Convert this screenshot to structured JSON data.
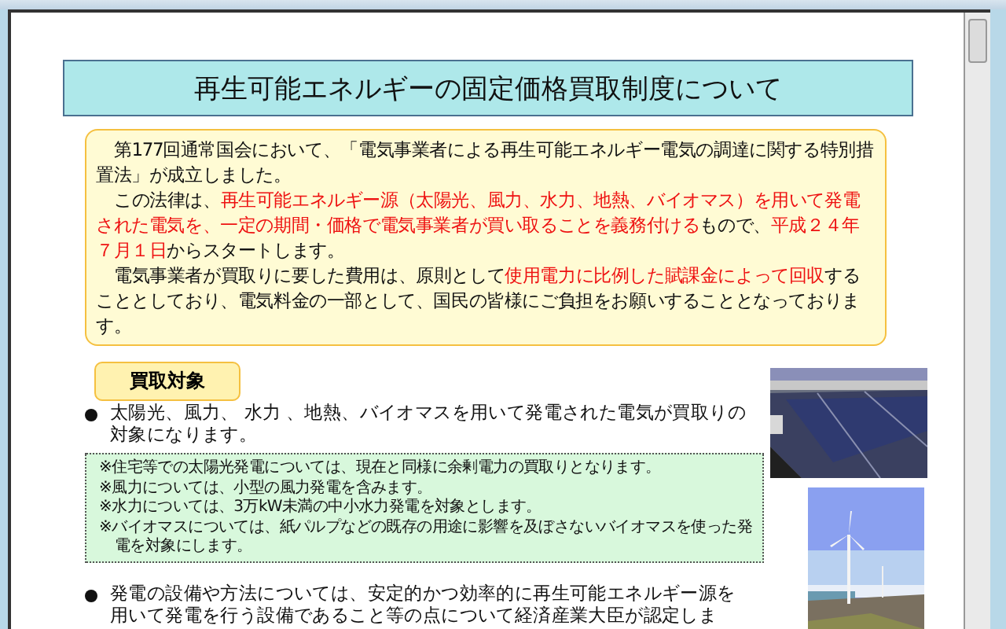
{
  "title": "再生可能エネルギーの固定価格買取制度について",
  "intro": [
    {
      "segments": [
        {
          "text": "第177回通常国会において、「電気事業者による再生可能エネルギー電気の調達に関する特別措置法」が成立しました。",
          "red": false
        }
      ]
    },
    {
      "segments": [
        {
          "text": "この法律は、",
          "red": false
        },
        {
          "text": "再生可能エネルギー源（太陽光、風力、水力、地熱、バイオマス）を用いて発電された電気を、一定の期間・価格で電気事業者が買い取ることを義務付ける",
          "red": true
        },
        {
          "text": "もので、",
          "red": false
        },
        {
          "text": "平成２４年７月１日",
          "red": true
        },
        {
          "text": "からスタートします。",
          "red": false
        }
      ]
    },
    {
      "segments": [
        {
          "text": "電気事業者が買取りに要した費用は、原則として",
          "red": false
        },
        {
          "text": "使用電力に比例した賦課金によって回収",
          "red": true
        },
        {
          "text": "することとしており、電気料金の一部として、国民の皆様にご負担をお願いすることとなっております。",
          "red": false
        }
      ]
    }
  ],
  "section_label": "買取対象",
  "bullets": [
    "太陽光、風力、 水力 、地熱、バイオマスを用いて発電された電気が買取りの対象になります。",
    "発電の設備や方法については、安定的かつ効率的に再生可能エネルギー源を用いて発電を行う設備であること等の点について経済産業大臣が認定しま"
  ],
  "notes": [
    "※住宅等での太陽光発電については、現在と同様に余剰電力の買取りとなります。",
    "※風力については、小型の風力発電を含みます。",
    "※水力については、3万kW未満の中小水力発電を対象とします。",
    "※バイオマスについては、紙パルプなどの既存の用途に影響を及ぼさないバイオマスを使った発電を対象にします。"
  ],
  "photos": [
    {
      "kind": "picture"
    },
    {
      "kind": "picture"
    }
  ]
}
